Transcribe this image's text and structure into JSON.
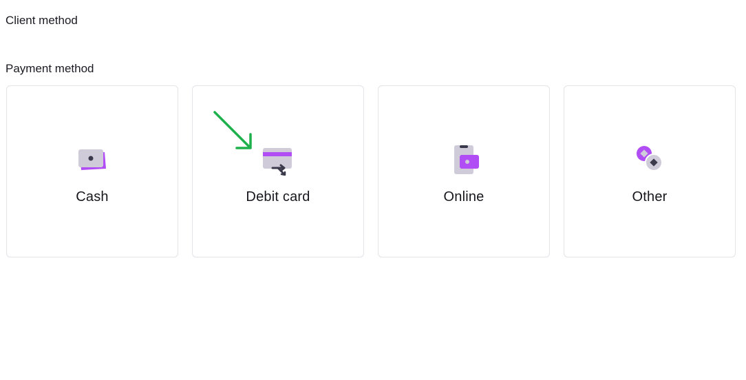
{
  "client_method": {
    "label": "Client method"
  },
  "payment_method": {
    "label": "Payment method",
    "options": [
      {
        "label": "Cash",
        "icon": "cash-icon"
      },
      {
        "label": "Debit card",
        "icon": "debit-card-icon"
      },
      {
        "label": "Online",
        "icon": "online-payment-icon"
      },
      {
        "label": "Other",
        "icon": "other-payment-icon"
      }
    ]
  },
  "annotation": {
    "icon": "arrow-icon",
    "color": "#1db04b"
  },
  "colors": {
    "accent": "#b14df5",
    "icon_muted": "#cfcbd9",
    "icon_dark": "#3b3a4d",
    "border": "#e3e3e8"
  }
}
